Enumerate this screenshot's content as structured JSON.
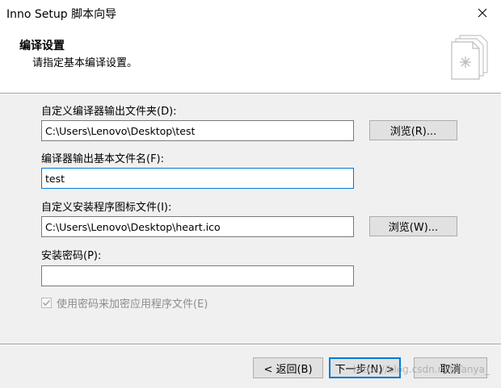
{
  "window": {
    "title": "Inno Setup 脚本向导"
  },
  "header": {
    "title": "编译设置",
    "subtitle": "请指定基本编译设置。",
    "icon": "wizard-pages-icon"
  },
  "form": {
    "output_folder": {
      "label": "自定义编译器输出文件夹(D):",
      "value": "C:\\Users\\Lenovo\\Desktop\\test",
      "browse_label": "浏览(R)..."
    },
    "output_basename": {
      "label": "编译器输出基本文件名(F):",
      "value": "test"
    },
    "setup_icon": {
      "label": "自定义安装程序图标文件(I):",
      "value": "C:\\Users\\Lenovo\\Desktop\\heart.ico",
      "browse_label": "浏览(W)..."
    },
    "password": {
      "label": "安装密码(P):",
      "value": ""
    },
    "encrypt": {
      "label": "使用密码来加密应用程序文件(E)",
      "checked": true,
      "enabled": false
    }
  },
  "footer": {
    "back_label": "< 返回(B)",
    "next_label": "下一步(N) >",
    "cancel_label": "取消"
  },
  "watermark": "https://blog.csdn.net/Tanya_",
  "colors": {
    "focus_border": "#0078d7",
    "button_face": "#e1e1e1",
    "panel_bg": "#f0f0f0",
    "disabled_text": "#8d8d8d"
  }
}
